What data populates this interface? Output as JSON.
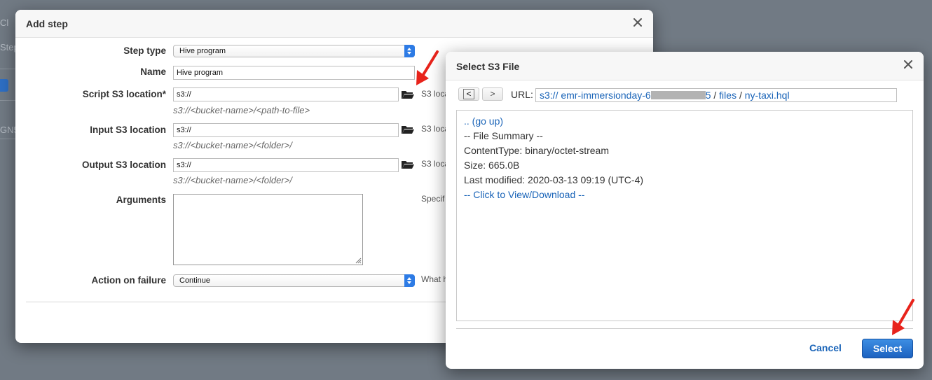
{
  "background": {
    "fragments": [
      "Cl",
      "Step",
      "GN5"
    ]
  },
  "add_step": {
    "title": "Add step",
    "fields": {
      "step_type": {
        "label": "Step type",
        "value": "Hive program"
      },
      "name": {
        "label": "Name",
        "value": "Hive program"
      },
      "script": {
        "label": "Script S3 location*",
        "value": "s3://",
        "hint": "s3://<bucket-name>/<path-to-file>",
        "side": "S3 loca"
      },
      "input": {
        "label": "Input S3 location",
        "value": "s3://",
        "hint": "s3://<bucket-name>/<folder>/",
        "side": "S3 loca"
      },
      "output": {
        "label": "Output S3 location",
        "value": "s3://",
        "hint": "s3://<bucket-name>/<folder>/",
        "side": "S3 loca"
      },
      "arguments": {
        "label": "Arguments",
        "side": "Specif"
      },
      "action_on_failure": {
        "label": "Action on failure",
        "value": "Continue",
        "side": "What h"
      }
    }
  },
  "select_s3": {
    "title": "Select S3 File",
    "back_label": "<",
    "forward_label": ">",
    "url_label": "URL:",
    "url": {
      "prefix": "s3:// emr-immersionday-6",
      "suffix": "5",
      "sep1": " / ",
      "folder": "files",
      "sep2": " / ",
      "file": "ny-taxi.hql"
    },
    "lines": {
      "go_up": ".. (go up)",
      "summary": "-- File Summary --",
      "content_type": "ContentType: binary/octet-stream",
      "size": "Size: 665.0B",
      "last_modified": "Last modified: 2020-03-13 09:19 (UTC-4)",
      "view_download": "-- Click to View/Download --"
    },
    "cancel_label": "Cancel",
    "select_label": "Select"
  },
  "colors": {
    "accent": "#1a64b8",
    "annotation_arrow": "#e8231b",
    "primary_button": "#1c62c0"
  }
}
